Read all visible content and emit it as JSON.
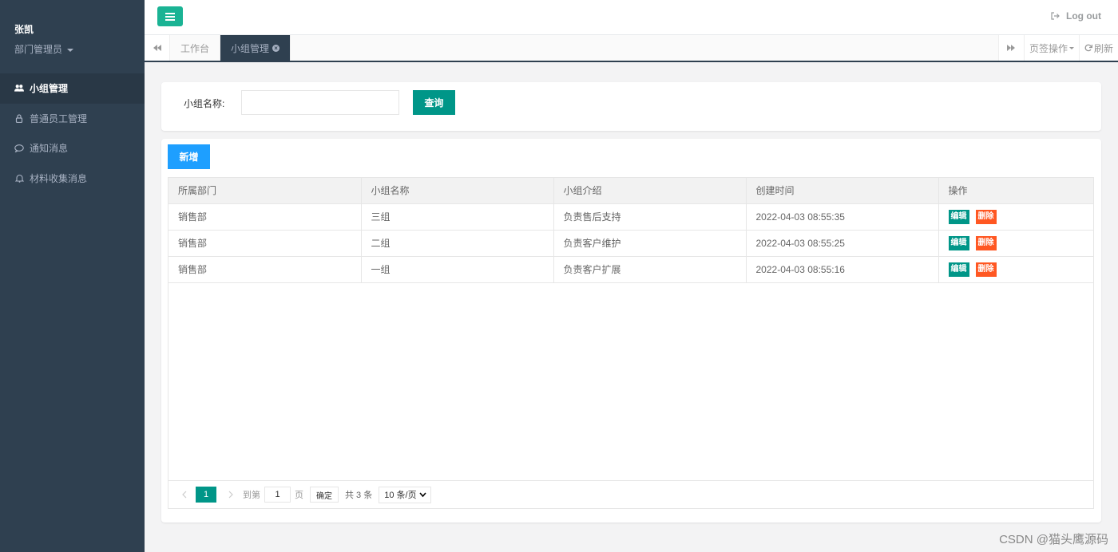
{
  "sidebar": {
    "user_name": "张凯",
    "user_role": "部门管理员",
    "items": [
      {
        "label": "小组管理",
        "icon": "users-icon"
      },
      {
        "label": "普通员工管理",
        "icon": "user-icon"
      },
      {
        "label": "通知消息",
        "icon": "comment-icon"
      },
      {
        "label": "材料收集消息",
        "icon": "bell-icon"
      }
    ]
  },
  "topbar": {
    "logout_label": "Log out"
  },
  "tabs": {
    "items": [
      "工作台",
      "小组管理"
    ],
    "page_ops_label": "页签操作",
    "refresh_label": "刷新"
  },
  "search": {
    "label": "小组名称:",
    "placeholder": "",
    "value": "",
    "query_label": "查询"
  },
  "table": {
    "add_label": "新增",
    "columns": [
      "所属部门",
      "小组名称",
      "小组介绍",
      "创建时间",
      "操作"
    ],
    "rows": [
      {
        "dept": "销售部",
        "name": "三组",
        "desc": "负责售后支持",
        "created": "2022-04-03 08:55:35"
      },
      {
        "dept": "销售部",
        "name": "二组",
        "desc": "负责客户维护",
        "created": "2022-04-03 08:55:25"
      },
      {
        "dept": "销售部",
        "name": "一组",
        "desc": "负责客户扩展",
        "created": "2022-04-03 08:55:16"
      }
    ],
    "edit_label": "编辑",
    "delete_label": "删除"
  },
  "pager": {
    "current": "1",
    "goto_label": "到第",
    "goto_value": "1",
    "page_unit": "页",
    "confirm_label": "确定",
    "total_label": "共 3 条",
    "page_size": "10 条/页"
  },
  "watermark": "CSDN @猫头鹰源码",
  "colors": {
    "sidebar_bg": "#2f4050",
    "accent_green": "#009688",
    "menu_green": "#1ab394",
    "add_blue": "#1e9fff",
    "delete_orange": "#ff5722"
  }
}
